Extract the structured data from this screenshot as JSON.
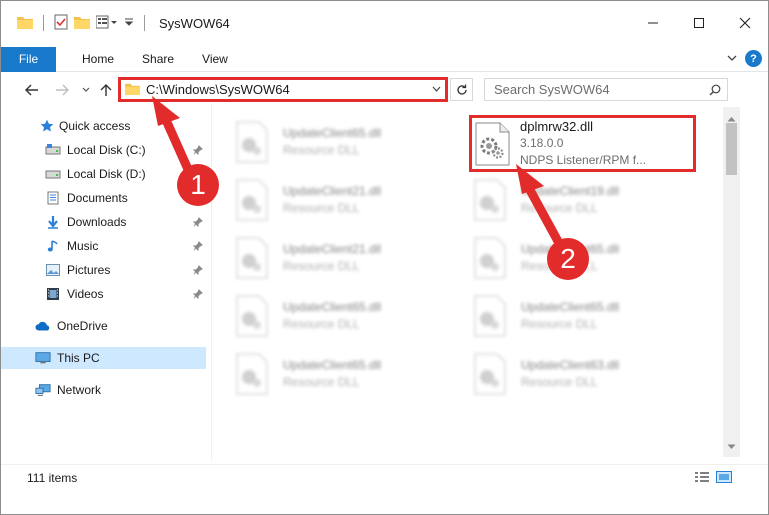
{
  "window": {
    "title": "SysWOW64",
    "controls": {
      "minimize": "—",
      "maximize": "☐",
      "close": "✕"
    }
  },
  "ribbon": {
    "tabs": [
      "File",
      "Home",
      "Share",
      "View"
    ],
    "help_label": "?"
  },
  "address_bar": {
    "path": "C:\\Windows\\SysWOW64"
  },
  "search": {
    "placeholder": "Search SysWOW64"
  },
  "sidebar": {
    "items": [
      {
        "label": "Quick access",
        "icon": "star-icon",
        "pinned": false
      },
      {
        "label": "Local Disk (C:)",
        "icon": "drive-icon",
        "pinned": true
      },
      {
        "label": "Local Disk (D:)",
        "icon": "drive-icon",
        "pinned": false
      },
      {
        "label": "Documents",
        "icon": "documents-icon",
        "pinned": true
      },
      {
        "label": "Downloads",
        "icon": "download-icon",
        "pinned": true
      },
      {
        "label": "Music",
        "icon": "music-icon",
        "pinned": true
      },
      {
        "label": "Pictures",
        "icon": "pictures-icon",
        "pinned": true
      },
      {
        "label": "Videos",
        "icon": "videos-icon",
        "pinned": true
      },
      {
        "label": "OneDrive",
        "icon": "cloud-icon",
        "pinned": false
      },
      {
        "label": "This PC",
        "icon": "computer-icon",
        "pinned": false,
        "selected": true
      },
      {
        "label": "Network",
        "icon": "network-icon",
        "pinned": false
      }
    ]
  },
  "files": {
    "highlighted": {
      "name": "dplmrw32.dll",
      "version": "3.18.0.0",
      "description": "NDPS Listener/RPM f..."
    },
    "left_column": [
      {
        "name": "UpdateClient65.dll",
        "type": "Resource DLL"
      },
      {
        "name": "UpdateClient21.dll",
        "type": "Resource DLL"
      },
      {
        "name": "UpdateClient21.dll",
        "type": "Resource DLL"
      },
      {
        "name": "UpdateClient65.dll",
        "type": "Resource DLL"
      },
      {
        "name": "UpdateClient65.dll",
        "type": "Resource DLL"
      }
    ],
    "right_column": [
      {
        "name": "UpdateClient19.dll",
        "type": "Resource DLL"
      },
      {
        "name": "UpdateClient65.dll",
        "type": "Resource DLL"
      },
      {
        "name": "UpdateClient65.dll",
        "type": "Resource DLL"
      },
      {
        "name": "UpdateClient63.dll",
        "type": "Resource DLL"
      }
    ]
  },
  "status_bar": {
    "item_count": "111 items"
  },
  "annotations": {
    "step1": "1",
    "step2": "2",
    "color": "#e22b2b"
  }
}
